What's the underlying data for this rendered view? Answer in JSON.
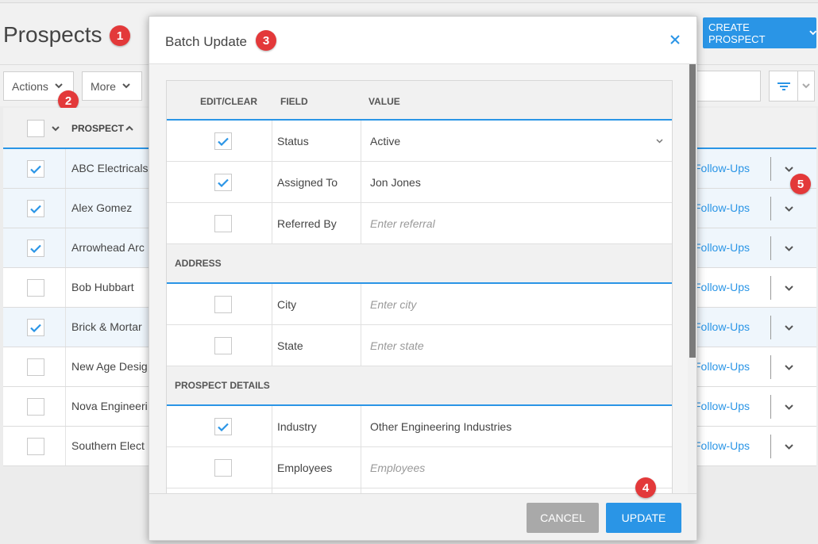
{
  "page": {
    "title": "Prospects",
    "create_label": "CREATE PROSPECT",
    "actions_label": "Actions",
    "more_label": "More",
    "column_prospect": "PROSPECT"
  },
  "badges": [
    "1",
    "2",
    "3",
    "4",
    "5"
  ],
  "rows": [
    {
      "name": "ABC Electricals",
      "selected": true,
      "link": "Follow-Ups"
    },
    {
      "name": "Alex Gomez",
      "selected": true,
      "link": "Follow-Ups"
    },
    {
      "name": "Arrowhead Arc",
      "selected": true,
      "link": "Follow-Ups"
    },
    {
      "name": "Bob Hubbart",
      "selected": false,
      "link": "Follow-Ups"
    },
    {
      "name": "Brick & Mortar",
      "selected": true,
      "link": "Follow-Ups"
    },
    {
      "name": "New Age Desig",
      "selected": false,
      "link": "Follow-Ups"
    },
    {
      "name": "Nova Engineeri",
      "selected": false,
      "link": "Follow-Ups"
    },
    {
      "name": "Southern Elect",
      "selected": false,
      "link": "Follow-Ups"
    }
  ],
  "modal": {
    "title": "Batch Update",
    "headers": {
      "edit": "EDIT/CLEAR",
      "field": "FIELD",
      "value": "VALUE"
    },
    "fields": [
      {
        "label": "Status",
        "value": "Active",
        "placeholder": "",
        "checked": true,
        "dropdown": true
      },
      {
        "label": "Assigned To",
        "value": "Jon Jones",
        "placeholder": "",
        "checked": true
      },
      {
        "label": "Referred By",
        "value": "",
        "placeholder": "Enter referral",
        "checked": false
      }
    ],
    "section_address": "ADDRESS",
    "address_fields": [
      {
        "label": "City",
        "placeholder": "Enter city",
        "checked": false
      },
      {
        "label": "State",
        "placeholder": "Enter state",
        "checked": false
      }
    ],
    "section_details": "PROSPECT DETAILS",
    "detail_fields": [
      {
        "label": "Industry",
        "value": "Other Engineering Industries",
        "placeholder": "",
        "checked": true
      },
      {
        "label": "Employees",
        "value": "",
        "placeholder": "Employees",
        "checked": false
      }
    ],
    "cancel_label": "CANCEL",
    "update_label": "UPDATE"
  },
  "colors": {
    "accent": "#2a95e6",
    "badge": "#e3393a",
    "cancel": "#a9a9a9"
  }
}
